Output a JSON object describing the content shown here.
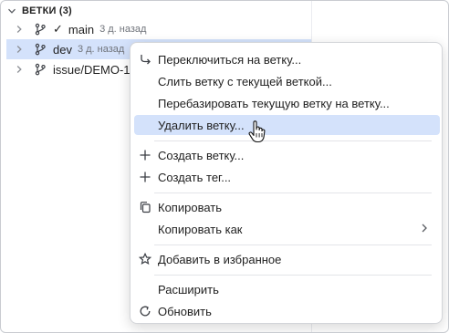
{
  "section": {
    "title": "ВЕТКИ (3)"
  },
  "branches": [
    {
      "check": "✓",
      "name": "main",
      "time": "3 д. назад"
    },
    {
      "name": "dev",
      "time": "3 д. назад"
    },
    {
      "name": "issue/DEMO-1"
    }
  ],
  "menu": {
    "items": [
      {
        "label": "Переключиться на ветку..."
      },
      {
        "label": "Слить ветку с текущей веткой..."
      },
      {
        "label": "Перебазировать текущую ветку на ветку..."
      },
      {
        "label": "Удалить ветку..."
      },
      {
        "label": "Создать ветку..."
      },
      {
        "label": "Создать тег..."
      },
      {
        "label": "Копировать"
      },
      {
        "label": "Копировать как"
      },
      {
        "label": "Добавить в избранное"
      },
      {
        "label": "Расширить"
      },
      {
        "label": "Обновить"
      }
    ]
  },
  "colors": {
    "selection": "#d4e2fb",
    "text": "#1f1f1f",
    "muted": "#6f737a"
  }
}
